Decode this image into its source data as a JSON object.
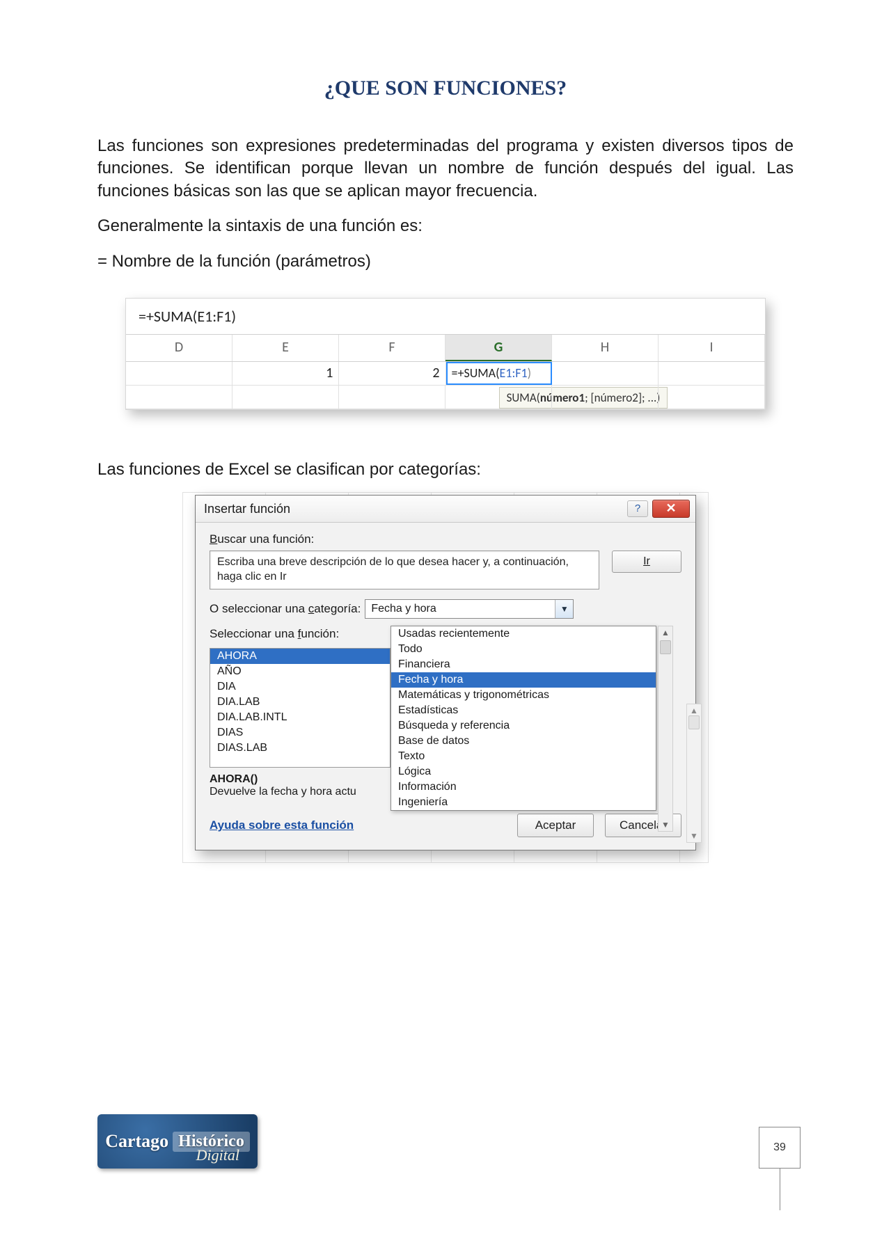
{
  "title": "¿QUE SON FUNCIONES?",
  "paragraphs": {
    "p1": "Las funciones son expresiones predeterminadas del programa y existen diversos tipos de funciones. Se identifican porque llevan un nombre de función después del igual. Las funciones básicas son las que se aplican mayor frecuencia.",
    "p2": "Generalmente la sintaxis de una función es:",
    "p3": "= Nombre de la función (parámetros)",
    "p4": "Las funciones de Excel se clasifican por categorías:"
  },
  "excel": {
    "formula_bar": "=+SUMA(E1:F1)",
    "columns": [
      "D",
      "E",
      "F",
      "G",
      "H",
      "I"
    ],
    "row1": {
      "E": "1",
      "F": "2",
      "G_prefix": "=+SUMA(",
      "G_range": "E1:F1",
      "G_suffix": ")"
    },
    "tooltip_func": "SUMA(",
    "tooltip_bold": "número1",
    "tooltip_rest": "; [número2]; ...)"
  },
  "dialog": {
    "title": "Insertar función",
    "search_label_pre": "B",
    "search_label_post": "uscar una función:",
    "search_text": "Escriba una breve descripción de lo que desea hacer y, a continuación, haga clic en Ir",
    "go_label": "Ir",
    "cat_label_pre": "O seleccionar una ",
    "cat_label_u": "c",
    "cat_label_post": "ategoría:",
    "cat_selected": "Fecha y hora",
    "select_func_label_pre": "Seleccionar una ",
    "select_func_label_u": "f",
    "select_func_label_post": "unción:",
    "functions": [
      "AHORA",
      "AÑO",
      "DIA",
      "DIA.LAB",
      "DIA.LAB.INTL",
      "DIAS",
      "DIAS.LAB"
    ],
    "categories": [
      "Usadas recientemente",
      "Todo",
      "Financiera",
      "Fecha y hora",
      "Matemáticas y trigonométricas",
      "Estadísticas",
      "Búsqueda y referencia",
      "Base de datos",
      "Texto",
      "Lógica",
      "Información",
      "Ingeniería"
    ],
    "detail_signature": "AHORA()",
    "detail_desc": "Devuelve la fecha y hora actu",
    "help_link": "Ayuda sobre esta función",
    "accept": "Aceptar",
    "cancel": "Cancelar"
  },
  "logo": {
    "w1": "Cartago",
    "w2": "Histórico",
    "sub": "Digital"
  },
  "page_number": "39"
}
